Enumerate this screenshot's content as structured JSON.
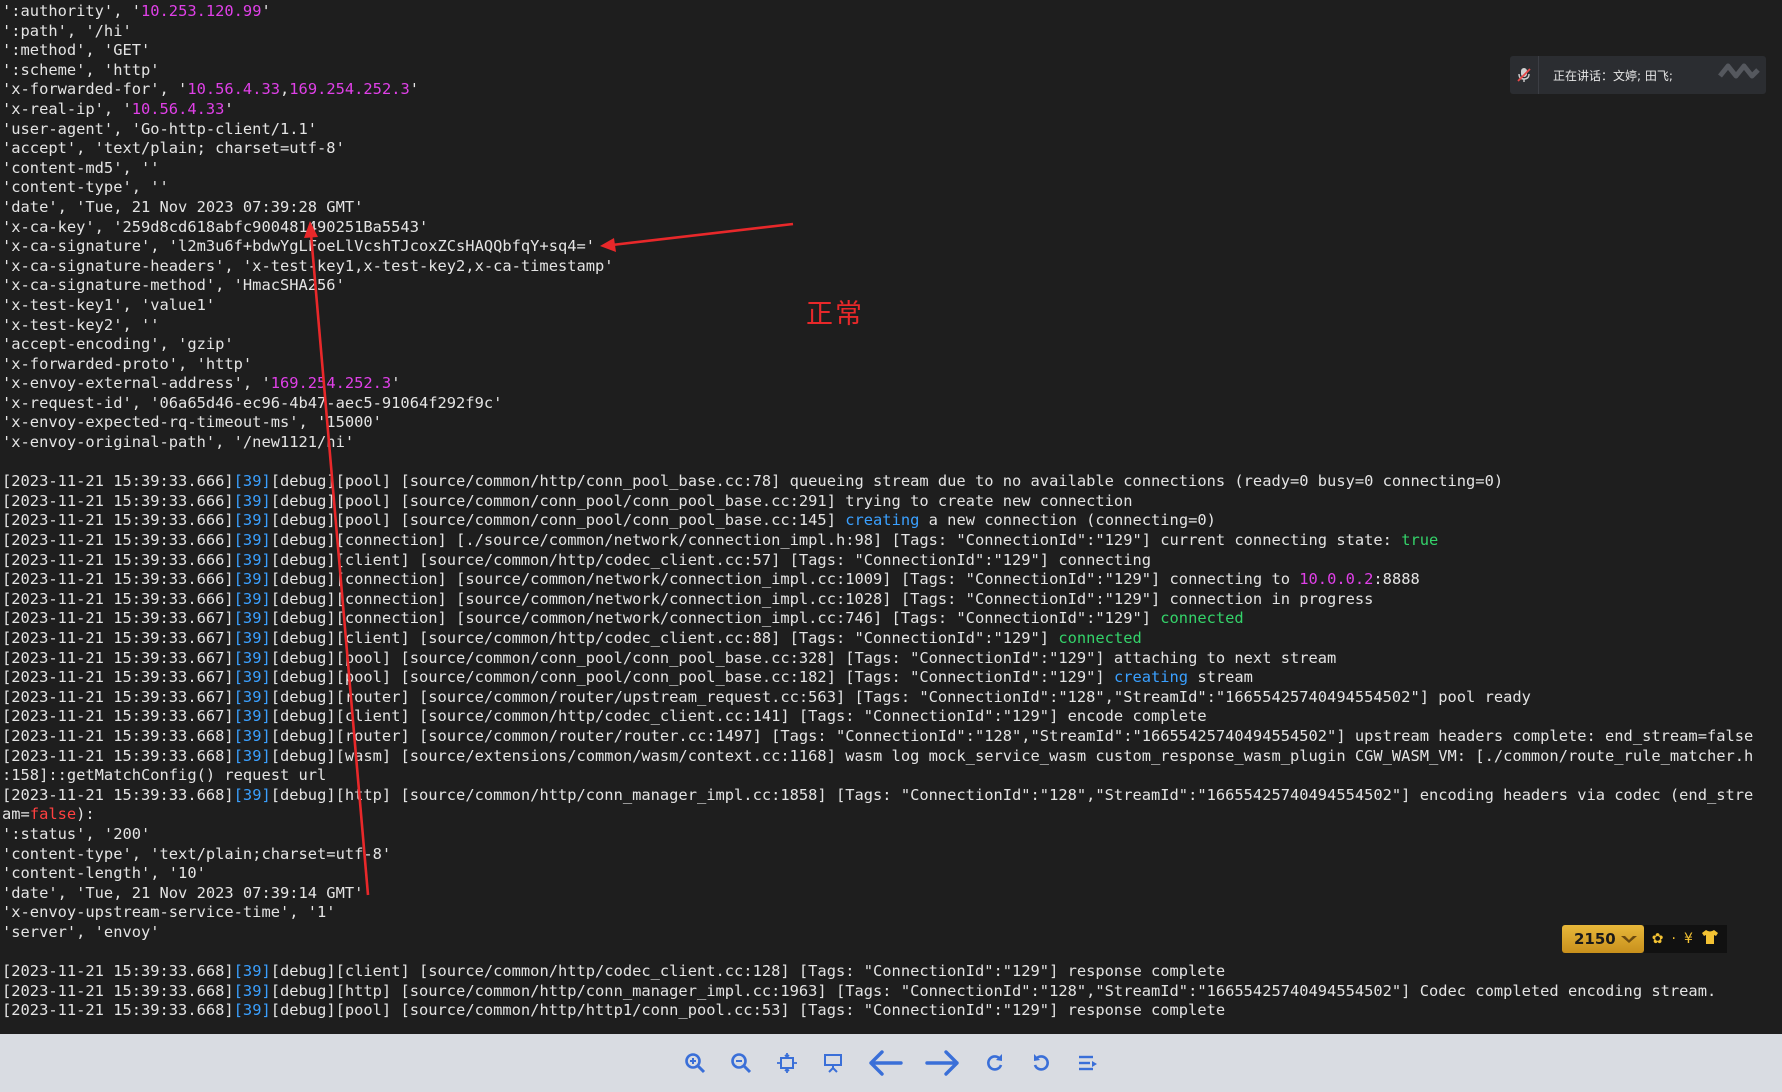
{
  "terminal": {
    "lines": [
      [
        [
          "':authority', '",
          ""
        ],
        [
          "10.253.120.99",
          "mag"
        ],
        [
          "'",
          ""
        ]
      ],
      [
        [
          "':path', '/hi'",
          ""
        ]
      ],
      [
        [
          "':method', 'GET'",
          ""
        ]
      ],
      [
        [
          "':scheme', 'http'",
          ""
        ]
      ],
      [
        [
          "'x-forwarded-for', '",
          ""
        ],
        [
          "10.56.4.33",
          "mag"
        ],
        [
          ",",
          ""
        ],
        [
          "169.254.252.3",
          "mag"
        ],
        [
          "'",
          ""
        ]
      ],
      [
        [
          "'x-real-ip', '",
          ""
        ],
        [
          "10.56.4.33",
          "mag"
        ],
        [
          "'",
          ""
        ]
      ],
      [
        [
          "'user-agent', 'Go-http-client/1.1'",
          ""
        ]
      ],
      [
        [
          "'accept', 'text/plain; charset=utf-8'",
          ""
        ]
      ],
      [
        [
          "'content-md5', ''",
          ""
        ]
      ],
      [
        [
          "'content-type', ''",
          ""
        ]
      ],
      [
        [
          "'date', 'Tue, 21 Nov 2023 07:39:28 GMT'",
          ""
        ]
      ],
      [
        [
          "'x-ca-key', '259d8cd618abfc900481490251Ba5543'",
          ""
        ]
      ],
      [
        [
          "'x-ca-signature', 'l2m3u6f+bdwYgLFoeLlVcshTJcoxZCsHAQQbfqY+sq4='",
          ""
        ]
      ],
      [
        [
          "'x-ca-signature-headers', 'x-test-key1,x-test-key2,x-ca-timestamp'",
          ""
        ]
      ],
      [
        [
          "'x-ca-signature-method', 'HmacSHA256'",
          ""
        ]
      ],
      [
        [
          "'x-test-key1', 'value1'",
          ""
        ]
      ],
      [
        [
          "'x-test-key2', ''",
          ""
        ]
      ],
      [
        [
          "'accept-encoding', 'gzip'",
          ""
        ]
      ],
      [
        [
          "'x-forwarded-proto', 'http'",
          ""
        ]
      ],
      [
        [
          "'x-envoy-external-address', '",
          ""
        ],
        [
          "169.254.252.3",
          "mag"
        ],
        [
          "'",
          ""
        ]
      ],
      [
        [
          "'x-request-id', '06a65d46-ec96-4b47-aec5-91064f292f9c'",
          ""
        ]
      ],
      [
        [
          "'x-envoy-expected-rq-timeout-ms', '15000'",
          ""
        ]
      ],
      [
        [
          "'x-envoy-original-path', '/new1121/hi'",
          ""
        ]
      ],
      [],
      [
        [
          "[2023-11-21 15:39:33.666]",
          ""
        ],
        [
          "[39]",
          "blue"
        ],
        [
          "[debug][pool] [source/common/http/conn_pool_base.cc:78] queueing stream due to no available connections (ready=0 busy=0 connecting=0)",
          ""
        ]
      ],
      [
        [
          "[2023-11-21 15:39:33.666]",
          ""
        ],
        [
          "[39]",
          "blue"
        ],
        [
          "[debug][pool] [source/common/conn_pool/conn_pool_base.cc:291] trying to create new connection",
          ""
        ]
      ],
      [
        [
          "[2023-11-21 15:39:33.666]",
          ""
        ],
        [
          "[39]",
          "blue"
        ],
        [
          "[debug][pool] [source/common/conn_pool/conn_pool_base.cc:145] ",
          ""
        ],
        [
          "creating",
          "blue"
        ],
        [
          " a new connection (connecting=0)",
          ""
        ]
      ],
      [
        [
          "[2023-11-21 15:39:33.666]",
          ""
        ],
        [
          "[39]",
          "blue"
        ],
        [
          "[debug][connection] [./source/common/network/connection_impl.h:98] [Tags: \"ConnectionId\":\"129\"] current connecting state: ",
          ""
        ],
        [
          "true",
          "green"
        ]
      ],
      [
        [
          "[2023-11-21 15:39:33.666]",
          ""
        ],
        [
          "[39]",
          "blue"
        ],
        [
          "[debug][client] [source/common/http/codec_client.cc:57] [Tags: \"ConnectionId\":\"129\"] connecting",
          ""
        ]
      ],
      [
        [
          "[2023-11-21 15:39:33.666]",
          ""
        ],
        [
          "[39]",
          "blue"
        ],
        [
          "[debug][connection] [source/common/network/connection_impl.cc:1009] [Tags: \"ConnectionId\":\"129\"] connecting to ",
          ""
        ],
        [
          "10.0.0.2",
          "mag"
        ],
        [
          ":8888",
          ""
        ]
      ],
      [
        [
          "[2023-11-21 15:39:33.666]",
          ""
        ],
        [
          "[39]",
          "blue"
        ],
        [
          "[debug][connection] [source/common/network/connection_impl.cc:1028] [Tags: \"ConnectionId\":\"129\"] connection in progress",
          ""
        ]
      ],
      [
        [
          "[2023-11-21 15:39:33.667]",
          ""
        ],
        [
          "[39]",
          "blue"
        ],
        [
          "[debug][connection] [source/common/network/connection_impl.cc:746] [Tags: \"ConnectionId\":\"129\"] ",
          ""
        ],
        [
          "connected",
          "green"
        ]
      ],
      [
        [
          "[2023-11-21 15:39:33.667]",
          ""
        ],
        [
          "[39]",
          "blue"
        ],
        [
          "[debug][client] [source/common/http/codec_client.cc:88] [Tags: \"ConnectionId\":\"129\"] ",
          ""
        ],
        [
          "connected",
          "green"
        ]
      ],
      [
        [
          "[2023-11-21 15:39:33.667]",
          ""
        ],
        [
          "[39]",
          "blue"
        ],
        [
          "[debug][pool] [source/common/conn_pool/conn_pool_base.cc:328] [Tags: \"ConnectionId\":\"129\"] attaching to next stream",
          ""
        ]
      ],
      [
        [
          "[2023-11-21 15:39:33.667]",
          ""
        ],
        [
          "[39]",
          "blue"
        ],
        [
          "[debug][pool] [source/common/conn_pool/conn_pool_base.cc:182] [Tags: \"ConnectionId\":\"129\"] ",
          ""
        ],
        [
          "creating",
          "blue"
        ],
        [
          " stream",
          ""
        ]
      ],
      [
        [
          "[2023-11-21 15:39:33.667]",
          ""
        ],
        [
          "[39]",
          "blue"
        ],
        [
          "[debug][router] [source/common/router/upstream_request.cc:563] [Tags: \"ConnectionId\":\"128\",\"StreamId\":\"16655425740494554502\"] pool ready",
          ""
        ]
      ],
      [
        [
          "[2023-11-21 15:39:33.667]",
          ""
        ],
        [
          "[39]",
          "blue"
        ],
        [
          "[debug][client] [source/common/http/codec_client.cc:141] [Tags: \"ConnectionId\":\"129\"] encode complete",
          ""
        ]
      ],
      [
        [
          "[2023-11-21 15:39:33.668]",
          ""
        ],
        [
          "[39]",
          "blue"
        ],
        [
          "[debug][router] [source/common/router/router.cc:1497] [Tags: \"ConnectionId\":\"128\",\"StreamId\":\"16655425740494554502\"] upstream headers complete: end_stream=false",
          ""
        ]
      ],
      [
        [
          "[2023-11-21 15:39:33.668]",
          ""
        ],
        [
          "[39]",
          "blue"
        ],
        [
          "[debug][wasm] [source/extensions/common/wasm/context.cc:1168] wasm log mock_service_wasm custom_response_wasm_plugin CGW_WASM_VM: [./common/route_rule_matcher.h",
          ""
        ]
      ],
      [
        [
          ":158]::getMatchConfig() request url",
          ""
        ]
      ],
      [
        [
          "[2023-11-21 15:39:33.668]",
          ""
        ],
        [
          "[39]",
          "blue"
        ],
        [
          "[debug][http] [source/common/http/conn_manager_impl.cc:1858] [Tags: \"ConnectionId\":\"128\",\"StreamId\":\"16655425740494554502\"] encoding headers via codec (end_stre",
          ""
        ]
      ],
      [
        [
          "am=",
          ""
        ],
        [
          "false",
          "red"
        ],
        [
          "):",
          ""
        ]
      ],
      [
        [
          "':status', '200'",
          ""
        ]
      ],
      [
        [
          "'content-type', 'text/plain;charset=utf-8'",
          ""
        ]
      ],
      [
        [
          "'content-length', '10'",
          ""
        ]
      ],
      [
        [
          "'date', 'Tue, 21 Nov 2023 07:39:14 GMT'",
          ""
        ]
      ],
      [
        [
          "'x-envoy-upstream-service-time', '1'",
          ""
        ]
      ],
      [
        [
          "'server', 'envoy'",
          ""
        ]
      ],
      [],
      [
        [
          "[2023-11-21 15:39:33.668]",
          ""
        ],
        [
          "[39]",
          "blue"
        ],
        [
          "[debug][client] [source/common/http/codec_client.cc:128] [Tags: \"ConnectionId\":\"129\"] response complete",
          ""
        ]
      ],
      [
        [
          "[2023-11-21 15:39:33.668]",
          ""
        ],
        [
          "[39]",
          "blue"
        ],
        [
          "[debug][http] [source/common/http/conn_manager_impl.cc:1963] [Tags: \"ConnectionId\":\"128\",\"StreamId\":\"16655425740494554502\"] Codec completed encoding stream.",
          ""
        ]
      ],
      [
        [
          "[2023-11-21 15:39:33.668]",
          ""
        ],
        [
          "[39]",
          "blue"
        ],
        [
          "[debug][pool] [source/common/http/http1/conn_pool.cc:53] [Tags: \"ConnectionId\":\"129\"] response complete",
          ""
        ]
      ]
    ]
  },
  "annotation": {
    "label": "正常",
    "color": "#e8282a"
  },
  "meeting_banner": {
    "text": "正在讲话：文婷; 田飞;",
    "mic_icon": "muted-mic-icon"
  },
  "score_widget": {
    "value": "2150",
    "icons": [
      "hand-icon",
      "flower-icon",
      "yen-icon",
      "shirt-icon"
    ]
  },
  "toolbar": {
    "buttons": [
      "zoom-in-icon",
      "zoom-out-icon",
      "fit-window-icon",
      "present-icon",
      "arrow-left-icon",
      "arrow-right-icon",
      "rotate-clockwise-icon",
      "rotate-counterclockwise-icon",
      "more-menu-icon"
    ]
  },
  "colors": {
    "background": "#1e1e1e",
    "text": "#e4e4e4",
    "magenta": "#e040e8",
    "blue": "#3aa0ff",
    "green": "#34d36a",
    "red": "#ff4040",
    "toolbar_bg": "#d9dce2",
    "toolbar_icon": "#3a6fd8"
  }
}
